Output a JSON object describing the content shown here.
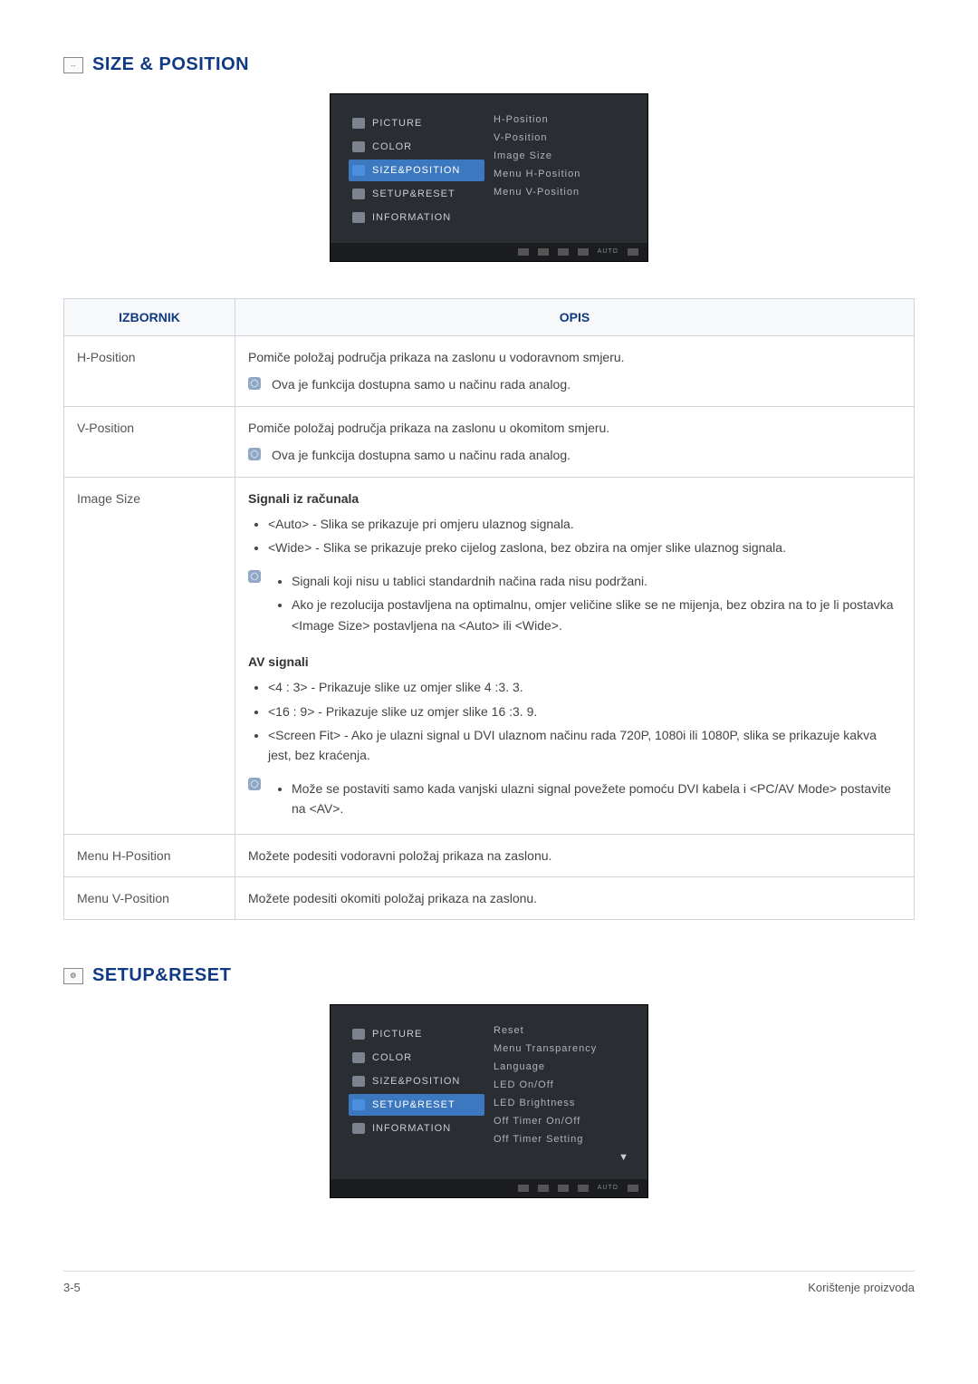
{
  "section1": {
    "title": "SIZE & POSITION",
    "iconGlyph": "↔"
  },
  "osd1": {
    "left": [
      {
        "label": "PICTURE",
        "selected": false
      },
      {
        "label": "COLOR",
        "selected": false
      },
      {
        "label": "SIZE&POSITION",
        "selected": true
      },
      {
        "label": "SETUP&RESET",
        "selected": false
      },
      {
        "label": "INFORMATION",
        "selected": false
      }
    ],
    "right": [
      "H-Position",
      "V-Position",
      "Image Size",
      "Menu H-Position",
      "Menu V-Position"
    ],
    "footerAuto": "AUTO"
  },
  "table1": {
    "headers": {
      "menu": "IZBORNIK",
      "desc": "OPIS"
    },
    "rows": {
      "hpos": {
        "menu": "H-Position",
        "desc": "Pomiče položaj područja prikaza na zaslonu u vodoravnom smjeru.",
        "note": "Ova je funkcija dostupna samo u načinu rada analog."
      },
      "vpos": {
        "menu": "V-Position",
        "desc": "Pomiče položaj područja prikaza na zaslonu u okomitom smjeru.",
        "note": "Ova je funkcija dostupna samo u načinu rada analog."
      },
      "imagesize": {
        "menu": "Image Size",
        "h1": "Signali iz računala",
        "b1": "<Auto> - Slika se prikazuje pri omjeru ulaznog signala.",
        "b2": "<Wide> - Slika se prikazuje preko cijelog zaslona, bez obzira na omjer slike ulaznog signala.",
        "n1": "Signali koji nisu u tablici standardnih načina rada nisu podržani.",
        "n2": "Ako je rezolucija postavljena na optimalnu, omjer veličine slike se ne mijenja, bez obzira na to je li postavka <Image Size> postavljena na <Auto> ili <Wide>.",
        "h2": "AV signali",
        "b3": "<4 : 3> - Prikazuje slike uz omjer slike 4 :3. 3.",
        "b4": "<16 : 9> - Prikazuje slike uz omjer slike 16 :3. 9.",
        "b5": "<Screen Fit> - Ako je ulazni signal u DVI ulaznom načinu rada 720P, 1080i ili 1080P, slika se prikazuje kakva jest, bez kraćenja.",
        "n3": "Može se postaviti samo kada vanjski ulazni signal povežete pomoću DVI kabela i <PC/AV Mode> postavite na <AV>."
      },
      "menuH": {
        "menu": "Menu H-Position",
        "desc": "Možete podesiti vodoravni položaj prikaza na zaslonu."
      },
      "menuV": {
        "menu": "Menu V-Position",
        "desc": "Možete podesiti okomiti položaj prikaza na zaslonu."
      }
    }
  },
  "section2": {
    "title": "SETUP&RESET",
    "iconGlyph": "⚙"
  },
  "osd2": {
    "left": [
      {
        "label": "PICTURE",
        "selected": false
      },
      {
        "label": "COLOR",
        "selected": false
      },
      {
        "label": "SIZE&POSITION",
        "selected": false
      },
      {
        "label": "SETUP&RESET",
        "selected": true
      },
      {
        "label": "INFORMATION",
        "selected": false
      }
    ],
    "right": [
      "Reset",
      "Menu Transparency",
      "Language",
      "LED On/Off",
      "LED Brightness",
      "Off Timer On/Off",
      "Off Timer Setting"
    ],
    "arrow": "▼",
    "footerAuto": "AUTO"
  },
  "footer": {
    "left": "3-5",
    "right": "Korištenje proizvoda"
  }
}
